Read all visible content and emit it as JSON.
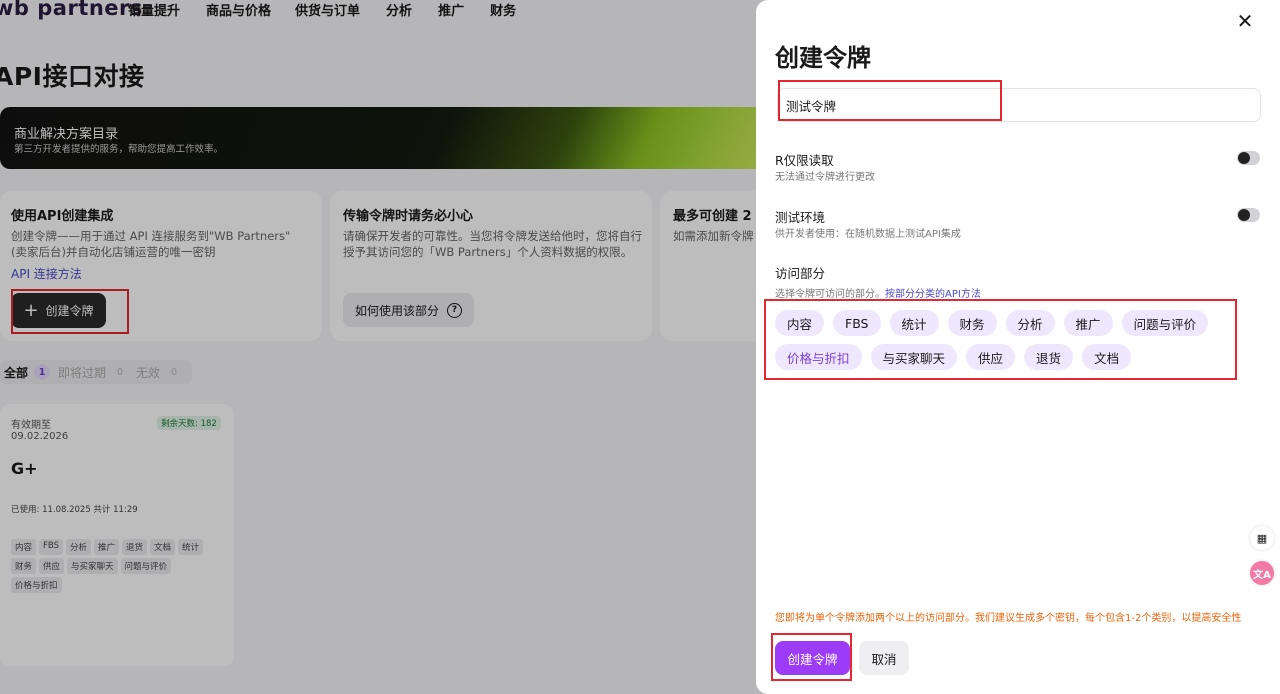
{
  "nav": {
    "logo": "wb partners",
    "items": [
      "销量提升",
      "商品与价格",
      "供货与订单",
      "分析",
      "推广",
      "财务"
    ]
  },
  "page_title": "API接口对接",
  "banner": {
    "title": "商业解决方案目录",
    "subtitle": "第三方开发者提供的服务，帮助您提高工作效率。"
  },
  "cards": [
    {
      "title": "使用API创建集成",
      "text": "创建令牌——用于通过 API 连接服务到\"WB Partners\"(卖家后台)并自动化店铺运营的唯一密钥",
      "link": "API 连接方法",
      "button": "创建令牌"
    },
    {
      "title": "传输令牌时请务必小心",
      "text": "请确保开发者的可靠性。当您将令牌发送给他时，您将自行授予其访问您的「WB Partners」个人资料数据的权限。",
      "button": "如何使用该部分"
    },
    {
      "title": "最多可创建 2",
      "text": "如需添加新令牌"
    }
  ],
  "filters": [
    {
      "label": "全部",
      "count": "1"
    },
    {
      "label": "即将过期",
      "count": "0"
    },
    {
      "label": "无效",
      "count": "0"
    }
  ],
  "token_card": {
    "valid_until_label": "有效期至",
    "valid_until_date": "09.02.2026",
    "days_left": "剩余天数: 182",
    "name": "G+",
    "used": "已使用: 11.08.2025 共计 11:29",
    "tags": [
      "内容",
      "FBS",
      "分析",
      "推广",
      "退货",
      "文档",
      "统计",
      "财务",
      "供应",
      "与买家聊天",
      "问题与评价",
      "价格与折扣"
    ]
  },
  "drawer": {
    "title": "创建令牌",
    "token_name_value": "测试令牌",
    "readonly": {
      "title": "R仅限读取",
      "subtitle": "无法通过令牌进行更改"
    },
    "test_env": {
      "title": "测试环境",
      "subtitle": "供开发者使用：在随机数据上测试API集成"
    },
    "access": {
      "title": "访问部分",
      "subtitle": "选择令牌可访问的部分。",
      "link": "按部分分类的API方法"
    },
    "chips": [
      "内容",
      "FBS",
      "统计",
      "财务",
      "分析",
      "推广",
      "问题与评价",
      "价格与折扣",
      "与买家聊天",
      "供应",
      "退货",
      "文档"
    ],
    "warning": "您即将为单个令牌添加两个以上的访问部分。我们建议生成多个密钥，每个包含1-2个类别，以提高安全性",
    "create_button": "创建令牌",
    "cancel_button": "取消"
  },
  "colors": {
    "accent": "#9c3cf7",
    "chip_bg": "#efe7fd",
    "warning": "#f0630a",
    "highlight": "#e3262f"
  }
}
